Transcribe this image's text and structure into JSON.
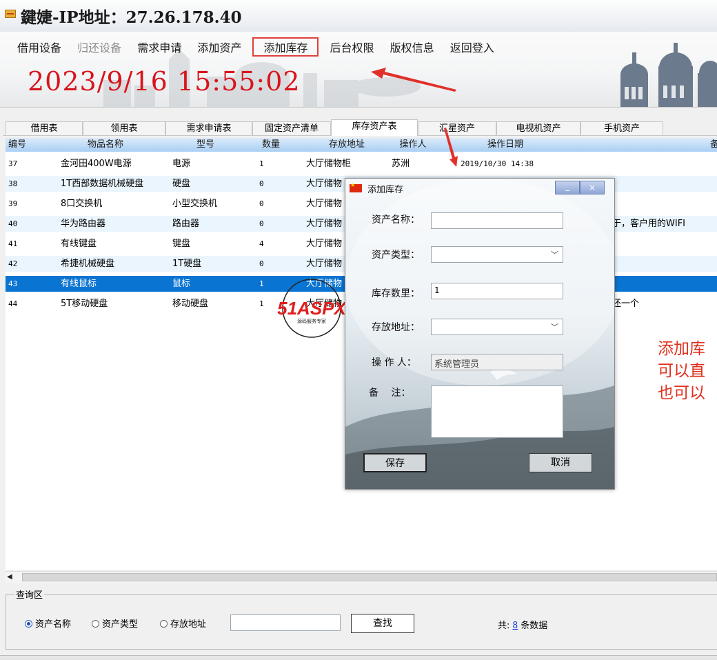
{
  "window": {
    "title": "鍵婕-IP地址：27.26.178.40"
  },
  "menu": [
    {
      "label": "借用设备",
      "state": "normal"
    },
    {
      "label": "归还设备",
      "state": "disabled"
    },
    {
      "label": "需求申请",
      "state": "normal"
    },
    {
      "label": "添加资产",
      "state": "normal"
    },
    {
      "label": "添加库存",
      "state": "active"
    },
    {
      "label": "后台权限",
      "state": "normal"
    },
    {
      "label": "版权信息",
      "state": "normal"
    },
    {
      "label": "返回登入",
      "state": "normal"
    }
  ],
  "datetime": "2023/9/16 15:55:02",
  "tabs": [
    "借用表",
    "领用表",
    "需求申请表",
    "固定资产清单",
    "库存资产表",
    "汇星资产",
    "电视机资产",
    "手机资产"
  ],
  "active_tab": "库存资产表",
  "grid": {
    "headers": [
      "编号",
      "物品名称",
      "型号",
      "数量",
      "存放地址",
      "操作人",
      "操作日期",
      "备"
    ],
    "rows": [
      {
        "id": "37",
        "name": "金河田400W电源",
        "model": "电源",
        "qty": "1",
        "location": "大厅储物柜",
        "operator": "苏洲",
        "date": "2019/10/30 14:38",
        "note": "",
        "selected": false
      },
      {
        "id": "38",
        "name": "1T西部数据机械硬盘",
        "model": "硬盘",
        "qty": "0",
        "location": "大厅储物",
        "operator": "",
        "date": "",
        "note": "",
        "selected": false
      },
      {
        "id": "39",
        "name": "8口交换机",
        "model": "小型交换机",
        "qty": "0",
        "location": "大厅储物",
        "operator": "",
        "date": "",
        "note": "",
        "selected": false
      },
      {
        "id": "40",
        "name": "华为路由器",
        "model": "路由器",
        "qty": "0",
        "location": "大厅储物",
        "operator": "",
        "date": "",
        "note": "于，客户用的WIFI",
        "selected": false
      },
      {
        "id": "41",
        "name": "有线键盘",
        "model": "键盘",
        "qty": "4",
        "location": "大厅储物",
        "operator": "",
        "date": "",
        "note": "",
        "selected": false
      },
      {
        "id": "42",
        "name": "希捷机械硬盘",
        "model": "1T硬盘",
        "qty": "0",
        "location": "大厅储物",
        "operator": "",
        "date": "",
        "note": "",
        "selected": false
      },
      {
        "id": "43",
        "name": "有线鼠标",
        "model": "鼠标",
        "qty": "1",
        "location": "大厅储物",
        "operator": "",
        "date": "",
        "note": "",
        "selected": true
      },
      {
        "id": "44",
        "name": "5T移动硬盘",
        "model": "移动硬盘",
        "qty": "1",
        "location": "大厅储物",
        "operator": "",
        "date": "",
        "note": "还一个",
        "selected": false
      }
    ]
  },
  "dialog": {
    "title": "添加库存",
    "min_label": "_",
    "close_label": "×",
    "fields": {
      "asset_name_label": "资产名称：",
      "asset_type_label": "资产类型：",
      "quantity_label": "库存数里：",
      "quantity_value": "1",
      "location_label": "存放地址：",
      "operator_label": "操 作 人：",
      "operator_value": "系统管理员",
      "remark_label": "备　 注："
    },
    "save_label": "保存",
    "cancel_label": "取消"
  },
  "annotation_lines": [
    "添加库",
    "可以直",
    "也可以"
  ],
  "watermark": {
    "brand": "51ASPX",
    "tagline": "源码服务专家"
  },
  "query": {
    "frame_label": "查询区",
    "radios": [
      {
        "label": "资产名称",
        "checked": true
      },
      {
        "label": "资产类型",
        "checked": false
      },
      {
        "label": "存放地址",
        "checked": false
      }
    ],
    "search_button": "查找",
    "total_prefix": "共:",
    "total_count": "8",
    "total_suffix": "条数据"
  },
  "colors": {
    "accent_red": "#e0403a",
    "datetime_red": "#d8141c",
    "selection_blue": "#0a74d2",
    "header_blue": "#a9cff3"
  }
}
